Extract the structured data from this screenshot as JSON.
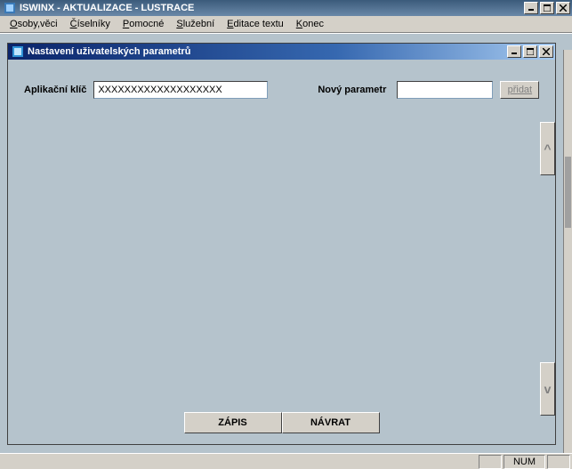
{
  "outer_window": {
    "title": "ISWINX - AKTUALIZACE - LUSTRACE"
  },
  "menu": {
    "items": [
      {
        "pre": "",
        "hot": "O",
        "post": "soby,věci"
      },
      {
        "pre": "",
        "hot": "Č",
        "post": "íselníky"
      },
      {
        "pre": "",
        "hot": "P",
        "post": "omocné"
      },
      {
        "pre": "",
        "hot": "S",
        "post": "lužební"
      },
      {
        "pre": "",
        "hot": "E",
        "post": "ditace textu"
      },
      {
        "pre": "",
        "hot": "K",
        "post": "onec"
      }
    ]
  },
  "mdi": {
    "title": "Nastavení uživatelských parametrů",
    "labels": {
      "app_key": "Aplikační klíč",
      "new_param": "Nový parametr"
    },
    "inputs": {
      "app_key_value": "XXXXXXXXXXXXXXXXXXX",
      "new_param_value": ""
    },
    "buttons": {
      "pridat": "přidat",
      "zapis": "ZÁPIS",
      "navrat": "NÁVRAT",
      "scroll_up": "^",
      "scroll_dn": "v"
    }
  },
  "status": {
    "num": "NUM"
  }
}
